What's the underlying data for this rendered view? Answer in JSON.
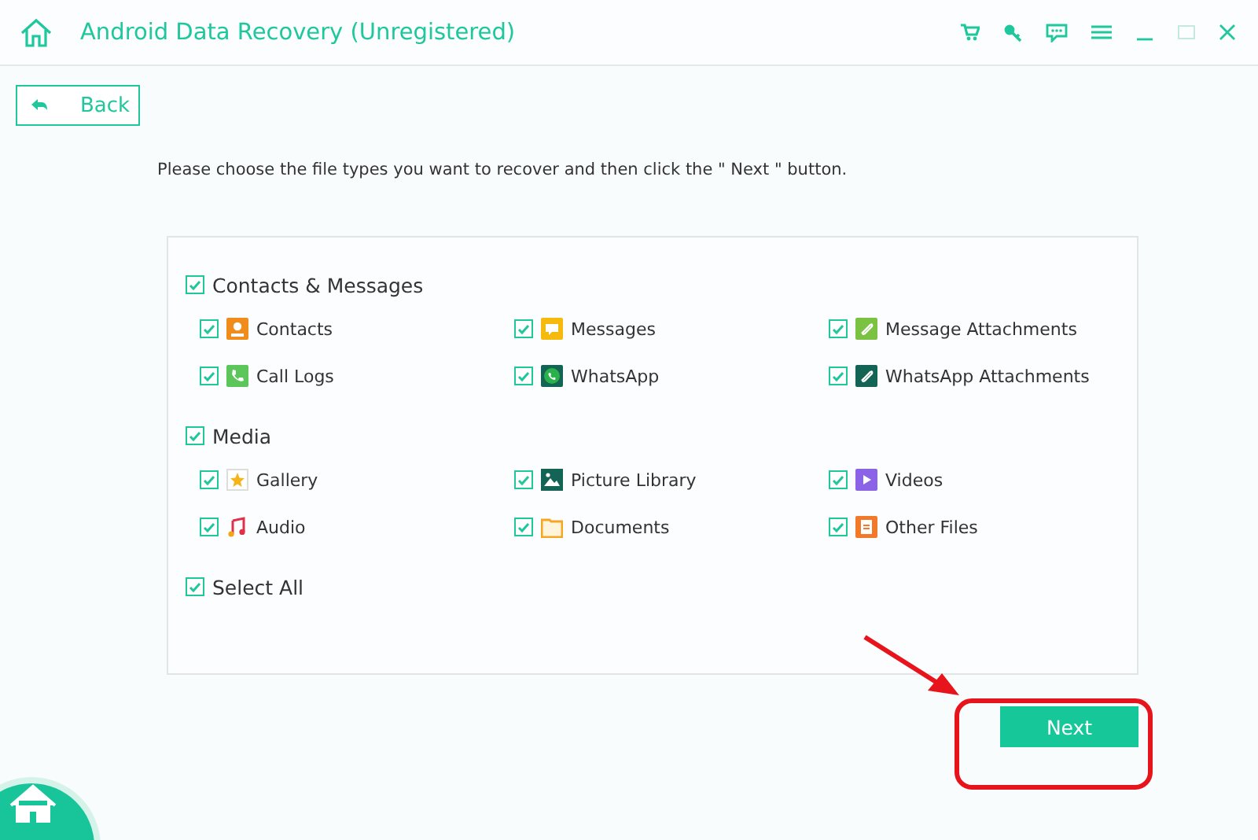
{
  "window": {
    "title": "Android Data Recovery (Unregistered)"
  },
  "back_button": {
    "label": "Back"
  },
  "instruction": "Please choose the file types you want to recover and then click the \" Next \" button.",
  "groups": [
    {
      "label": "Contacts & Messages",
      "checked": true,
      "items": [
        {
          "label": "Contacts",
          "checked": true
        },
        {
          "label": "Messages",
          "checked": true
        },
        {
          "label": "Message Attachments",
          "checked": true
        },
        {
          "label": "Call Logs",
          "checked": true
        },
        {
          "label": "WhatsApp",
          "checked": true
        },
        {
          "label": "WhatsApp Attachments",
          "checked": true
        }
      ]
    },
    {
      "label": "Media",
      "checked": true,
      "items": [
        {
          "label": "Gallery",
          "checked": true
        },
        {
          "label": "Picture Library",
          "checked": true
        },
        {
          "label": "Videos",
          "checked": true
        },
        {
          "label": "Audio",
          "checked": true
        },
        {
          "label": "Documents",
          "checked": true
        },
        {
          "label": "Other Files",
          "checked": true
        }
      ]
    }
  ],
  "select_all": {
    "label": "Select All",
    "checked": true
  },
  "next_button": {
    "label": "Next"
  }
}
